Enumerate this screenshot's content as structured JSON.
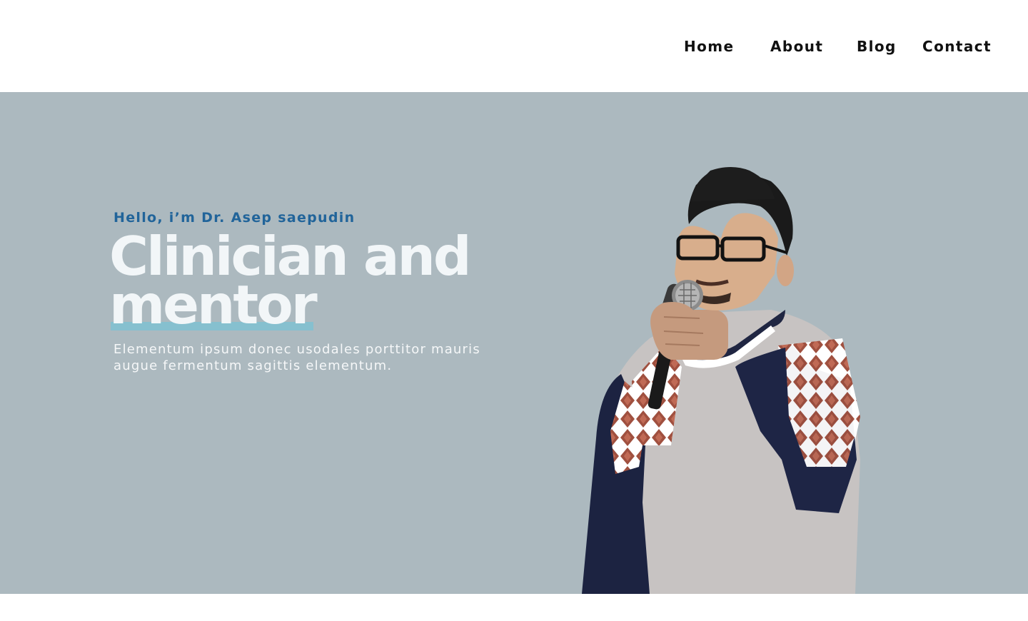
{
  "nav": {
    "items": [
      "Home",
      "About",
      "Blog",
      "Contact"
    ]
  },
  "hero": {
    "greeting": "Hello, i’m Dr. Asep saepudin",
    "headline_line1": "Clinician and",
    "headline_line2": "mentor",
    "description": "Elementum ipsum donec usodales porttitor mauris augue fermentum sagittis elementum.",
    "portrait": "person-speaking-with-microphone",
    "colors": {
      "background": "#acb9bf",
      "greeting": "#21649a",
      "headline": "#f2f6f8",
      "highlight": "#86c0cf"
    }
  }
}
